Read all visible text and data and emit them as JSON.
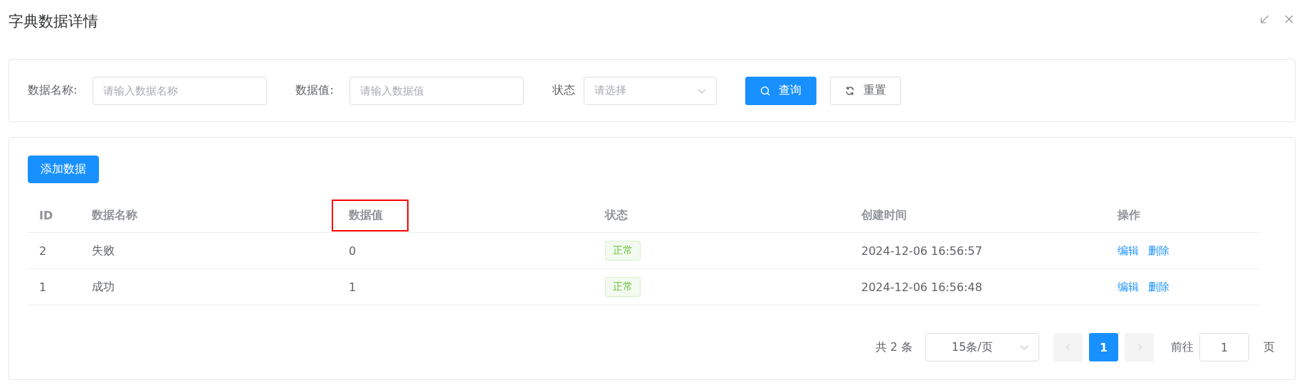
{
  "dialog": {
    "title": "字典数据详情"
  },
  "filters": [
    {
      "kind": "input",
      "label": "数据名称:",
      "placeholder": "请输入数据名称"
    },
    {
      "kind": "input",
      "label": "数据值:",
      "placeholder": "请输入数据值"
    },
    {
      "kind": "select",
      "label": "状态",
      "placeholder": "请选择"
    }
  ],
  "search_button": "查询",
  "reset_button": "重置",
  "add_button": "添加数据",
  "table": {
    "columns": [
      {
        "label": "ID",
        "highlighted": false
      },
      {
        "label": "数据名称",
        "highlighted": false
      },
      {
        "label": "数据值",
        "highlighted": true
      },
      {
        "label": "状态",
        "highlighted": false
      },
      {
        "label": "创建时间",
        "highlighted": false
      },
      {
        "label": "操作",
        "highlighted": false
      }
    ],
    "rows": [
      {
        "id": "2",
        "name": "失败",
        "value": "0",
        "status": {
          "label": "正常",
          "color": "#67c23a"
        },
        "created": "2024-12-06 16:56:57",
        "actions": [
          "编辑",
          "删除"
        ]
      },
      {
        "id": "1",
        "name": "成功",
        "value": "1",
        "status": {
          "label": "正常",
          "color": "#67c23a"
        },
        "created": "2024-12-06 16:56:48",
        "actions": [
          "编辑",
          "删除"
        ]
      }
    ]
  },
  "pagination": {
    "total": "共 2 条",
    "page_size": "15条/页",
    "pages": [
      {
        "label": "1",
        "selected": true
      }
    ],
    "goto_label": "前往",
    "goto_value": "1",
    "goto_suffix": "页"
  }
}
